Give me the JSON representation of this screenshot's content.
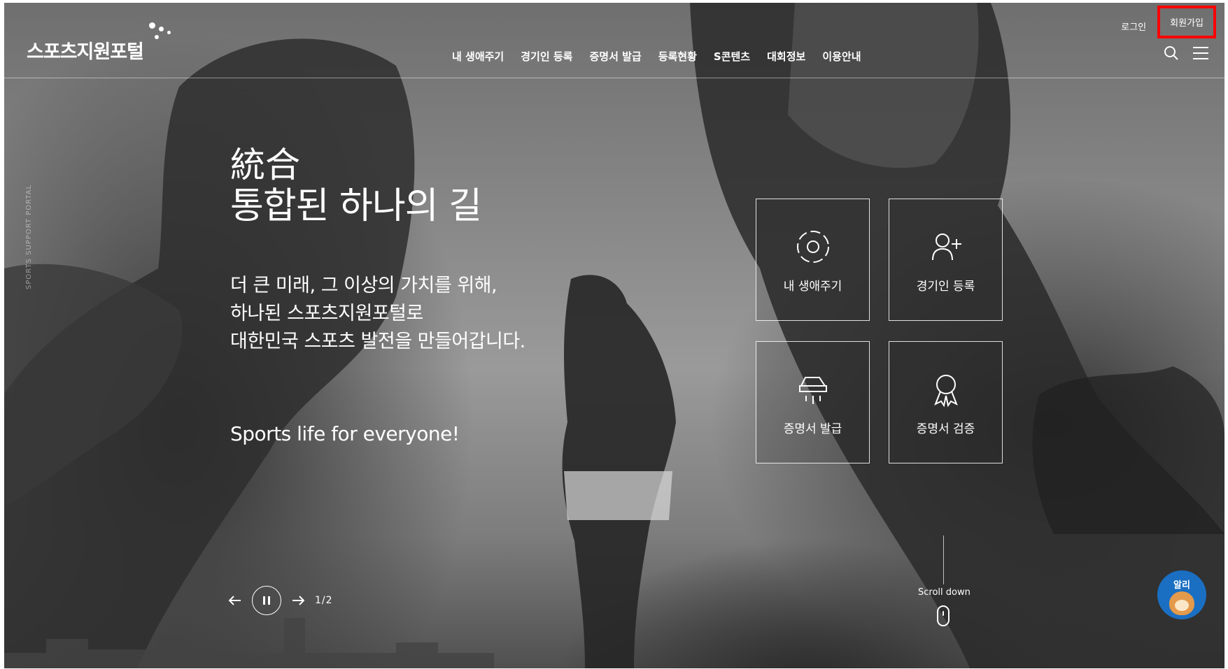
{
  "header": {
    "logo_text": "스포츠지원포털",
    "nav": [
      {
        "label": "내 생애주기"
      },
      {
        "label": "경기인 등록"
      },
      {
        "label": "증명서 발급"
      },
      {
        "label": "등록현황"
      },
      {
        "label": "S콘텐츠"
      },
      {
        "label": "대회정보"
      },
      {
        "label": "이용안내"
      }
    ],
    "util": {
      "login": "로그인",
      "signup": "회원가입"
    },
    "icons": [
      "search-icon",
      "menu-icon"
    ]
  },
  "hero": {
    "hanja": "統合",
    "title": "통합된 하나의 길",
    "desc": [
      "더 큰 미래, 그 이상의 가치를 위해,",
      "하나된 스포츠지원포털로",
      "대한민국 스포츠 발전을 만들어갑니다."
    ],
    "slogan": "Sports life for everyone!",
    "side_label": "SPORTS SUPPORT PORTAL"
  },
  "quick_menu": [
    {
      "label": "내 생애주기",
      "icon": "lifecycle-icon"
    },
    {
      "label": "경기인 등록",
      "icon": "user-add-icon"
    },
    {
      "label": "증명서 발급",
      "icon": "printer-icon"
    },
    {
      "label": "증명서 검증",
      "icon": "award-icon"
    }
  ],
  "slider": {
    "current": 1,
    "total": 2,
    "pager_text": "1/2"
  },
  "scroll": {
    "label": "Scroll down"
  },
  "chatbot": {
    "label": "알리"
  },
  "colors": {
    "highlight": "#ff0000",
    "chatbot": "#1a6fc2"
  }
}
